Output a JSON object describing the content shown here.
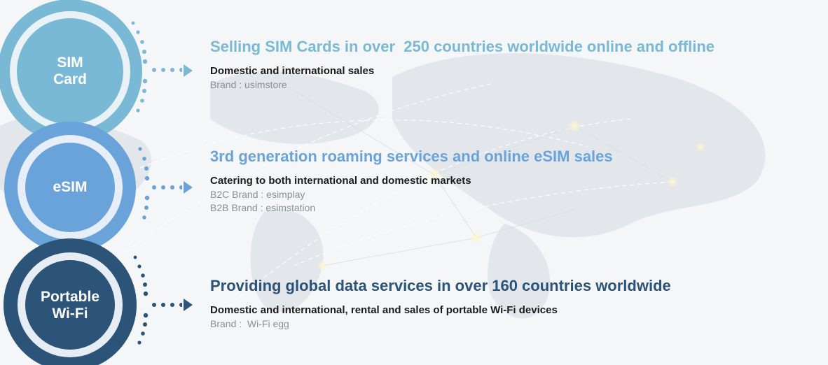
{
  "colors": {
    "sim": "#7ab9d6",
    "esim": "#6aa3d9",
    "wifi": "#2c5378",
    "text_dark": "#1b1b1b",
    "text_muted": "#8b8f93"
  },
  "services": [
    {
      "circle_label": "SIM\nCard",
      "title": "Selling SIM Cards in over  250 countries worldwide online and offline",
      "subtitle": "Domestic and international sales",
      "brands": [
        "Brand : usimstore"
      ]
    },
    {
      "circle_label": "eSIM",
      "title": "3rd generation roaming services and online eSIM sales",
      "subtitle": "Catering to both international and domestic markets",
      "brands": [
        "B2C Brand : esimplay",
        "B2B Brand : esimstation"
      ]
    },
    {
      "circle_label": "Portable\nWi-Fi",
      "title": "Providing global data services in over 160 countries worldwide",
      "subtitle": "Domestic and international, rental and sales of portable Wi-Fi devices",
      "brands": [
        "Brand :  Wi-Fi egg"
      ]
    }
  ]
}
